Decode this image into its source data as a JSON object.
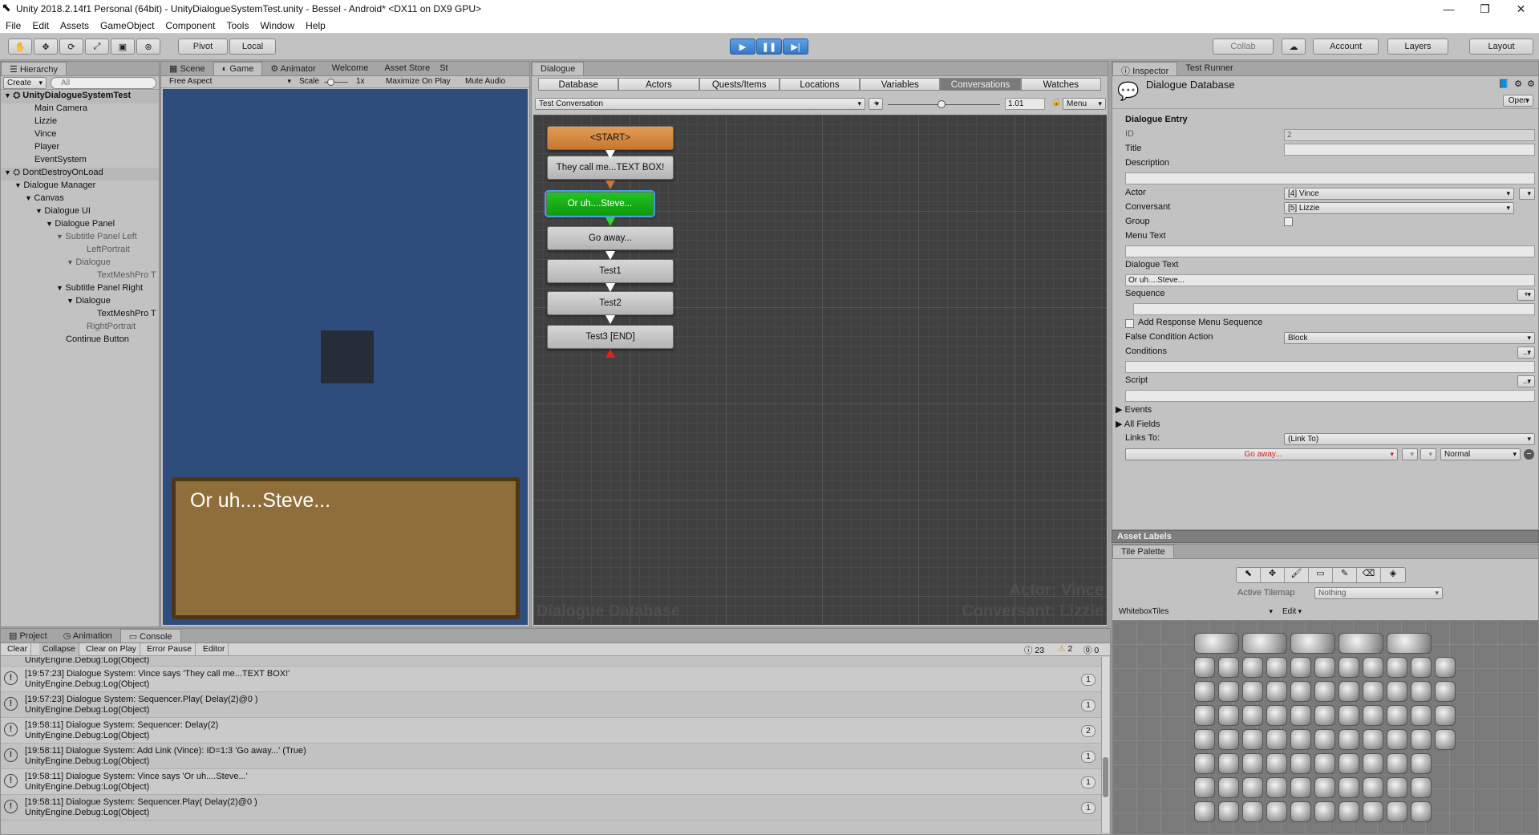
{
  "window": {
    "title": "Unity 2018.2.14f1 Personal (64bit) - UnityDialogueSystemTest.unity - Bessel - Android* <DX11 on DX9 GPU>",
    "minimize": "—",
    "maximize": "❐",
    "close": "✕"
  },
  "menu": [
    "File",
    "Edit",
    "Assets",
    "GameObject",
    "Component",
    "Tools",
    "Window",
    "Help"
  ],
  "toolbar": {
    "pivot": "Pivot",
    "local": "Local",
    "collab": "Collab",
    "account": "Account",
    "layers": "Layers",
    "layout": "Layout"
  },
  "hierarchy": {
    "tab": "Hierarchy",
    "create": "Create",
    "search_placeholder": "All",
    "items": [
      {
        "label": "UnityDialogueSystemTest",
        "indent": 0,
        "bold": true,
        "fold": "open",
        "scene": true
      },
      {
        "label": "Main Camera",
        "indent": 2
      },
      {
        "label": "Lizzie",
        "indent": 2
      },
      {
        "label": "Vince",
        "indent": 2
      },
      {
        "label": "Player",
        "indent": 2
      },
      {
        "label": "EventSystem",
        "indent": 2
      },
      {
        "label": "DontDestroyOnLoad",
        "indent": 0,
        "fold": "open",
        "scene": true
      },
      {
        "label": "Dialogue Manager",
        "indent": 1,
        "fold": "open"
      },
      {
        "label": "Canvas",
        "indent": 2,
        "fold": "open"
      },
      {
        "label": "Dialogue UI",
        "indent": 3,
        "fold": "open"
      },
      {
        "label": "Dialogue Panel",
        "indent": 4,
        "fold": "open"
      },
      {
        "label": "Subtitle Panel Left",
        "indent": 5,
        "fold": "open",
        "grey": true
      },
      {
        "label": "LeftPortrait",
        "indent": 7,
        "grey": true
      },
      {
        "label": "Dialogue",
        "indent": 6,
        "fold": "open",
        "grey": true
      },
      {
        "label": "TextMeshPro T",
        "indent": 8,
        "grey": true
      },
      {
        "label": "Subtitle Panel Right",
        "indent": 5,
        "fold": "open"
      },
      {
        "label": "Dialogue",
        "indent": 6,
        "fold": "open"
      },
      {
        "label": "TextMeshPro T",
        "indent": 8
      },
      {
        "label": "RightPortrait",
        "indent": 7,
        "grey": true
      },
      {
        "label": "Continue Button",
        "indent": 5
      }
    ]
  },
  "game": {
    "tabs": [
      "Scene",
      "Game",
      "Animator",
      "Welcome",
      "Asset Store",
      "St"
    ],
    "aspect": "Free Aspect",
    "scale_label": "Scale",
    "scale_value": "1x",
    "maximize": "Maximize On Play",
    "mute": "Mute Audio",
    "dialogue_text": "Or uh....Steve..."
  },
  "dialogue_editor": {
    "tab": "Dialogue",
    "tabs": [
      "Database",
      "Actors",
      "Quests/Items",
      "Locations",
      "Variables",
      "Conversations",
      "Watches"
    ],
    "active_tab": 5,
    "conversation": "Test Conversation",
    "plus": "+",
    "zoom": "1.01",
    "menu": "Menu",
    "nodes": [
      {
        "label": "<START>",
        "kind": "start"
      },
      {
        "label": "They call me...TEXT BOX!",
        "kind": "normal"
      },
      {
        "label": "Or uh....Steve...",
        "kind": "active"
      },
      {
        "label": "Go away...",
        "kind": "normal"
      },
      {
        "label": "Test1",
        "kind": "normal"
      },
      {
        "label": "Test2",
        "kind": "normal"
      },
      {
        "label": "Test3 [END]",
        "kind": "normal"
      }
    ],
    "watermark_left": "Dialogue Database",
    "watermark_actor": "Actor: Vince",
    "watermark_conversant": "Conversant: Lizzie"
  },
  "inspector": {
    "tabs": [
      "Inspector",
      "Test Runner"
    ],
    "object_title": "Dialogue Database",
    "open_button": "Open",
    "section": "Dialogue Entry",
    "id_label": "ID",
    "id_value": "2",
    "title_label": "Title",
    "description_label": "Description",
    "actor_label": "Actor",
    "actor_value": "[4] Vince",
    "conversant_label": "Conversant",
    "conversant_value": "[5] Lizzie",
    "group_label": "Group",
    "menu_text_label": "Menu Text",
    "dialogue_text_label": "Dialogue Text",
    "dialogue_text_value": "Or uh....Steve...",
    "sequence_label": "Sequence",
    "add_response_label": "Add Response Menu Sequence",
    "false_condition_label": "False Condition Action",
    "false_condition_value": "Block",
    "conditions_label": "Conditions",
    "script_label": "Script",
    "events_label": "Events",
    "all_fields_label": "All Fields",
    "links_to_label": "Links To:",
    "links_to_value": "(Link To)",
    "link_target": "Go away...",
    "link_priority": "Normal",
    "dots": "...",
    "asset_labels": "Asset Labels"
  },
  "tile_palette": {
    "tab": "Tile Palette",
    "active_tilemap_label": "Active Tilemap",
    "active_tilemap_value": "Nothing",
    "palette": "WhiteboxTiles",
    "edit": "Edit"
  },
  "console": {
    "tabs": [
      "Project",
      "Animation",
      "Console"
    ],
    "buttons": [
      "Clear",
      "Collapse",
      "Clear on Play",
      "Error Pause",
      "Editor"
    ],
    "count_info": "23",
    "count_warn": "2",
    "count_error": "0",
    "first_partial": "UnityEngine.Debug:Log(Object)",
    "entries": [
      {
        "line1": "[19:57:23] Dialogue System: Vince says 'They call me...TEXT BOX!'",
        "line2": "UnityEngine.Debug:Log(Object)",
        "count": "1"
      },
      {
        "line1": "[19:57:23] Dialogue System: Sequencer.Play( Delay(2)@0 )",
        "line2": "UnityEngine.Debug:Log(Object)",
        "count": "1"
      },
      {
        "line1": "[19:58:11] Dialogue System: Sequencer: Delay(2)",
        "line2": "UnityEngine.Debug:Log(Object)",
        "count": "2"
      },
      {
        "line1": "[19:58:11] Dialogue System: Add Link (Vince): ID=1:3 'Go away...' (True)",
        "line2": "UnityEngine.Debug:Log(Object)",
        "count": "1"
      },
      {
        "line1": "[19:58:11] Dialogue System: Vince says 'Or uh....Steve...'",
        "line2": "UnityEngine.Debug:Log(Object)",
        "count": "1"
      },
      {
        "line1": "[19:58:11] Dialogue System: Sequencer.Play( Delay(2)@0 )",
        "line2": "UnityEngine.Debug:Log(Object)",
        "count": "1"
      }
    ]
  },
  "colors": {
    "game_bg": "#2f4d7c",
    "dialog_box": "#8f6e3a",
    "node_start": "#d9893f",
    "node_active": "#18b018",
    "graph_bg": "#404040"
  }
}
